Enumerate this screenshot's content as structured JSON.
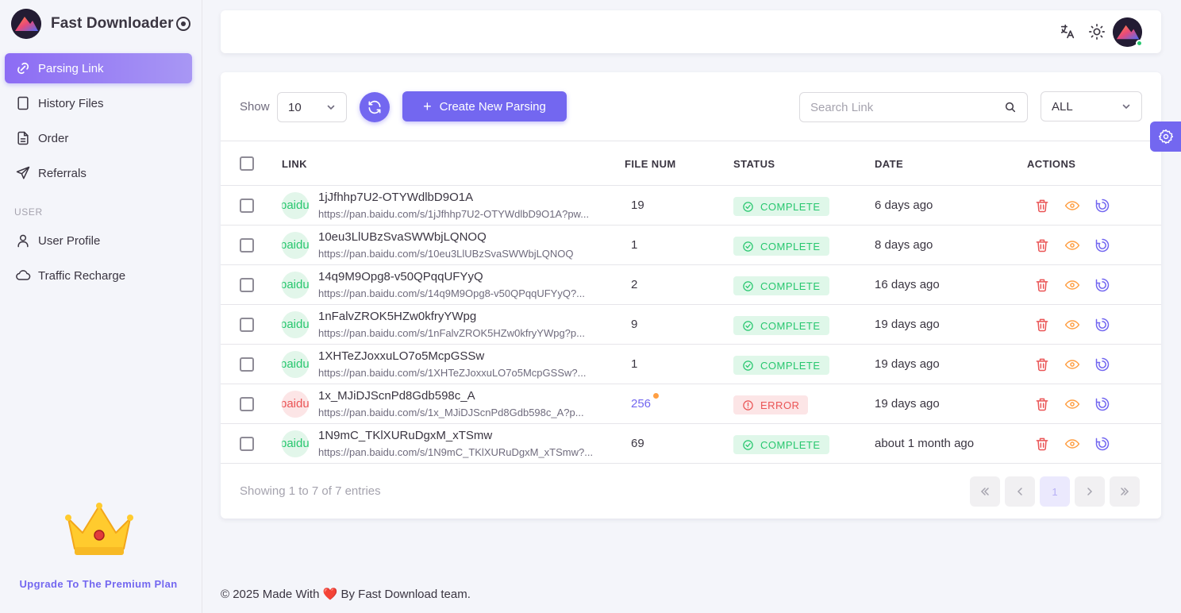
{
  "brand": {
    "name": "Fast Downloader"
  },
  "nav": {
    "items": [
      {
        "label": "Parsing Link",
        "icon": "link-icon",
        "active": true
      },
      {
        "label": "History Files",
        "icon": "file-icon"
      },
      {
        "label": "Order",
        "icon": "document-icon"
      },
      {
        "label": "Referrals",
        "icon": "send-icon"
      }
    ],
    "section_user": "USER",
    "user_items": [
      {
        "label": "User Profile",
        "icon": "user-icon"
      },
      {
        "label": "Traffic Recharge",
        "icon": "cloud-icon"
      }
    ]
  },
  "upgrade": {
    "label": "Upgrade To The Premium Plan"
  },
  "toolbar": {
    "show_label": "Show",
    "page_size": "10",
    "create_label": "Create New Parsing",
    "search_placeholder": "Search Link",
    "filter_value": "ALL"
  },
  "table": {
    "headers": {
      "link": "LINK",
      "file_num": "FILE NUM",
      "status": "STATUS",
      "date": "DATE",
      "actions": "ACTIONS"
    },
    "rows": [
      {
        "badge": "baidu",
        "title": "1jJfhhp7U2-OTYWdlbD9O1A",
        "url": "https://pan.baidu.com/s/1jJfhhp7U2-OTYWdlbD9O1A?pw...",
        "file_num": "19",
        "status": "COMPLETE",
        "date": "6 days ago"
      },
      {
        "badge": "baidu",
        "title": "10eu3LlUBzSvaSWWbjLQNOQ",
        "url": "https://pan.baidu.com/s/10eu3LlUBzSvaSWWbjLQNOQ",
        "file_num": "1",
        "status": "COMPLETE",
        "date": "8 days ago"
      },
      {
        "badge": "baidu",
        "title": "14q9M9Opg8-v50QPqqUFYyQ",
        "url": "https://pan.baidu.com/s/14q9M9Opg8-v50QPqqUFYyQ?...",
        "file_num": "2",
        "status": "COMPLETE",
        "date": "16 days ago"
      },
      {
        "badge": "baidu",
        "title": "1nFalvZROK5HZw0kfryYWpg",
        "url": "https://pan.baidu.com/s/1nFalvZROK5HZw0kfryYWpg?p...",
        "file_num": "9",
        "status": "COMPLETE",
        "date": "19 days ago"
      },
      {
        "badge": "baidu",
        "title": "1XHTeZJoxxuLO7o5McpGSSw",
        "url": "https://pan.baidu.com/s/1XHTeZJoxxuLO7o5McpGSSw?...",
        "file_num": "1",
        "status": "COMPLETE",
        "date": "19 days ago"
      },
      {
        "badge": "baidu",
        "title": "1x_MJiDJScnPd8Gdb598c_A",
        "url": "https://pan.baidu.com/s/1x_MJiDJScnPd8Gdb598c_A?p...",
        "file_num": "256",
        "status": "ERROR",
        "date": "19 days ago"
      },
      {
        "badge": "baidu",
        "title": "1N9mC_TKlXURuDgxM_xTSmw",
        "url": "https://pan.baidu.com/s/1N9mC_TKlXURuDgxM_xTSmw?...",
        "file_num": "69",
        "status": "COMPLETE",
        "date": "about 1 month ago"
      }
    ]
  },
  "pagination": {
    "info": "Showing 1 to 7 of 7 entries",
    "current_page": "1"
  },
  "footer": {
    "prefix": "© 2025 Made With",
    "heart": "❤️",
    "suffix": "By Fast Download team."
  },
  "colors": {
    "primary": "#7367f0",
    "success": "#28c76f",
    "danger": "#ea5455",
    "warning": "#ff9f43"
  }
}
